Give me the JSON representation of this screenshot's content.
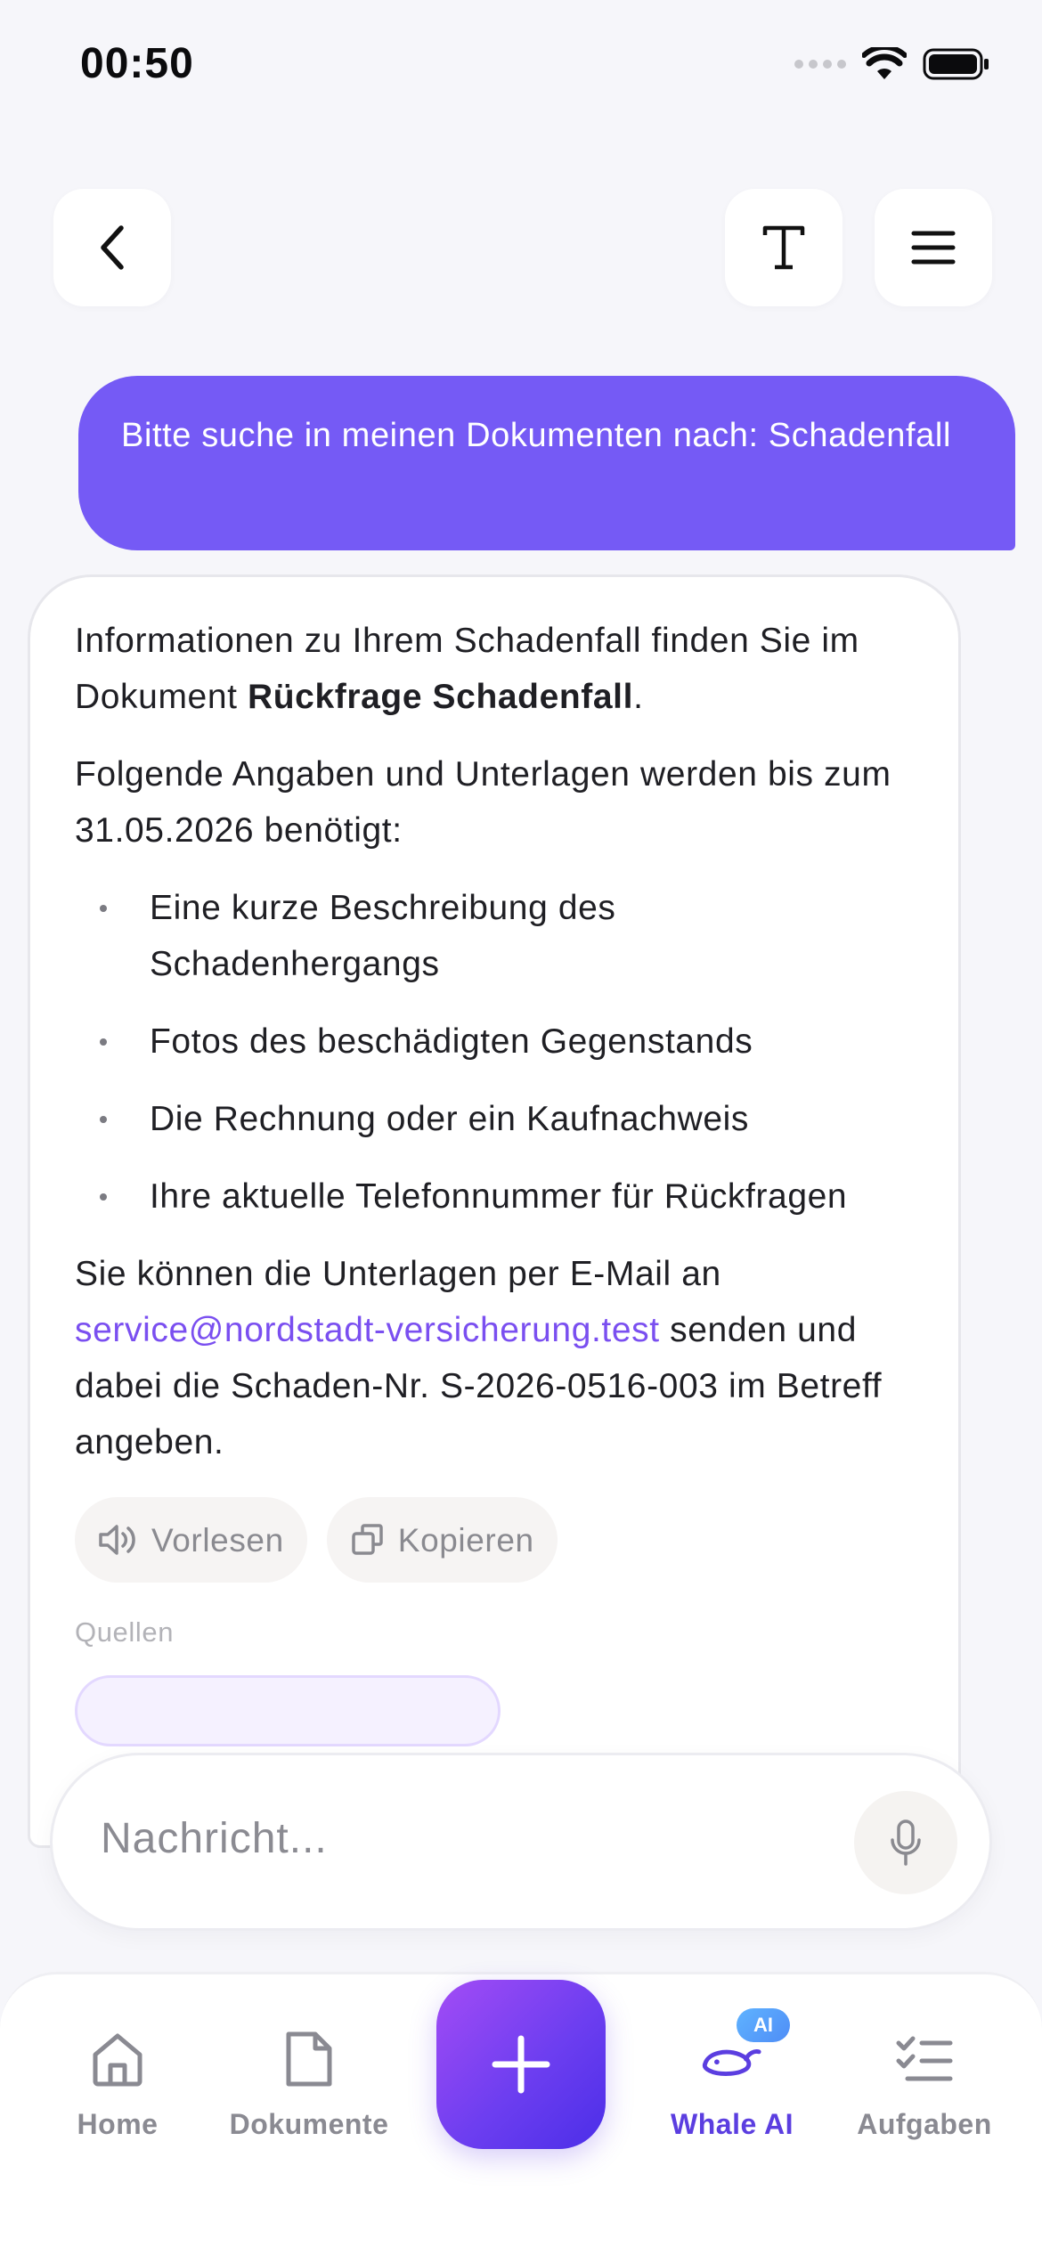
{
  "status_bar": {
    "time": "00:50"
  },
  "chat": {
    "user_message": "Bitte suche in meinen Dokumenten nach: Schadenfall",
    "assistant": {
      "intro_prefix": "Informationen zu Ihrem Schadenfall finden Sie im Dokument ",
      "intro_doc": "Rückfrage Schadenfall",
      "intro_suffix": ".",
      "needed_text": "Folgende Angaben und Unterlagen werden bis zum 31.05.2026 benötigt:",
      "bullets": [
        "Eine kurze Beschreibung des Schadenhergangs",
        "Fotos des beschädigten Gegenstands",
        "Die Rechnung oder ein Kaufnachweis",
        "Ihre aktuelle Telefonnummer für Rückfragen"
      ],
      "email_prefix": "Sie können die Unterlagen per E-Mail an ",
      "email": "service@nordstadt-versicherung.test",
      "email_suffix": " senden und dabei die Schaden-Nr. S-2026-0516-003 im Betreff angeben.",
      "read_aloud_label": "Vorlesen",
      "copy_label": "Kopieren",
      "sources_label": "Quellen"
    }
  },
  "input": {
    "placeholder": "Nachricht..."
  },
  "tabs": [
    {
      "label": "Home",
      "icon": "home-icon"
    },
    {
      "label": "Dokumente",
      "icon": "document-icon"
    },
    {
      "label": "Whale AI",
      "icon": "whale-ai-icon",
      "badge": "AI",
      "active": true
    },
    {
      "label": "Aufgaben",
      "icon": "tasks-icon"
    }
  ],
  "colors": {
    "accent": "#755af5",
    "active_tab": "#5b3ee0",
    "link": "#7a4ff0",
    "background": "#f6f6fa"
  }
}
